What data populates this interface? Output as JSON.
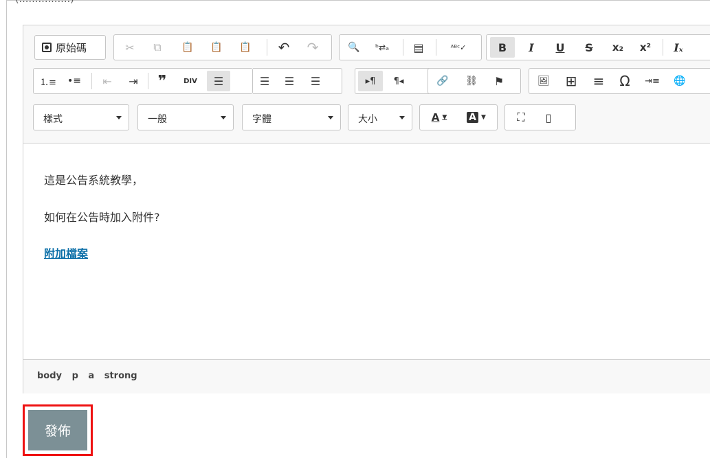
{
  "header_fragment": "(‥‥‥‥‥‥‥‥)",
  "toolbar": {
    "source_label": "原始碼",
    "combos": {
      "styles": "樣式",
      "format": "一般",
      "font": "字體",
      "size": "大小"
    },
    "glyphs": {
      "cut": "✂",
      "copy": "⧉",
      "paste": "📋",
      "paste_text": "📋",
      "paste_word": "📋",
      "undo": "↶",
      "redo": "↷",
      "find": "🔍",
      "replace": "ᵇ⇄ₐ",
      "select_all": "▤",
      "spell": "ᴬᴮᶜ✓",
      "bold": "B",
      "italic": "I",
      "underline": "U",
      "strike": "S",
      "subscript": "x₂",
      "superscript": "x²",
      "remove_format": "Iₓ",
      "numbered_list": "⒈≡",
      "bulleted_list": "•≡",
      "outdent": "⇤",
      "indent": "⇥",
      "blockquote": "❞",
      "div": "DIV",
      "align_left": "☰",
      "align_center": "☰",
      "align_right": "☰",
      "justify": "☰",
      "ltr": "▸¶",
      "rtl": "¶◂",
      "link": "🔗",
      "unlink": "⛓",
      "anchor": "⚑",
      "image": "🖼",
      "table": "⊞",
      "hr": "≡",
      "special_char": "Ω",
      "page_break": "⇥≡",
      "iframe": "🌐",
      "text_color": "A",
      "bg_color": "A",
      "maximize": "⛶",
      "show_blocks": "▯"
    }
  },
  "content": {
    "line1": "這是公告系統教學，",
    "line2": "如何在公告時加入附件?",
    "link_text": "附加檔案"
  },
  "path": [
    "body",
    "p",
    "a",
    "strong"
  ],
  "publish_label": "發佈",
  "colors": {
    "publish_bg": "#7c9096",
    "highlight_border": "#ee1111",
    "link": "#0c6fa8"
  }
}
